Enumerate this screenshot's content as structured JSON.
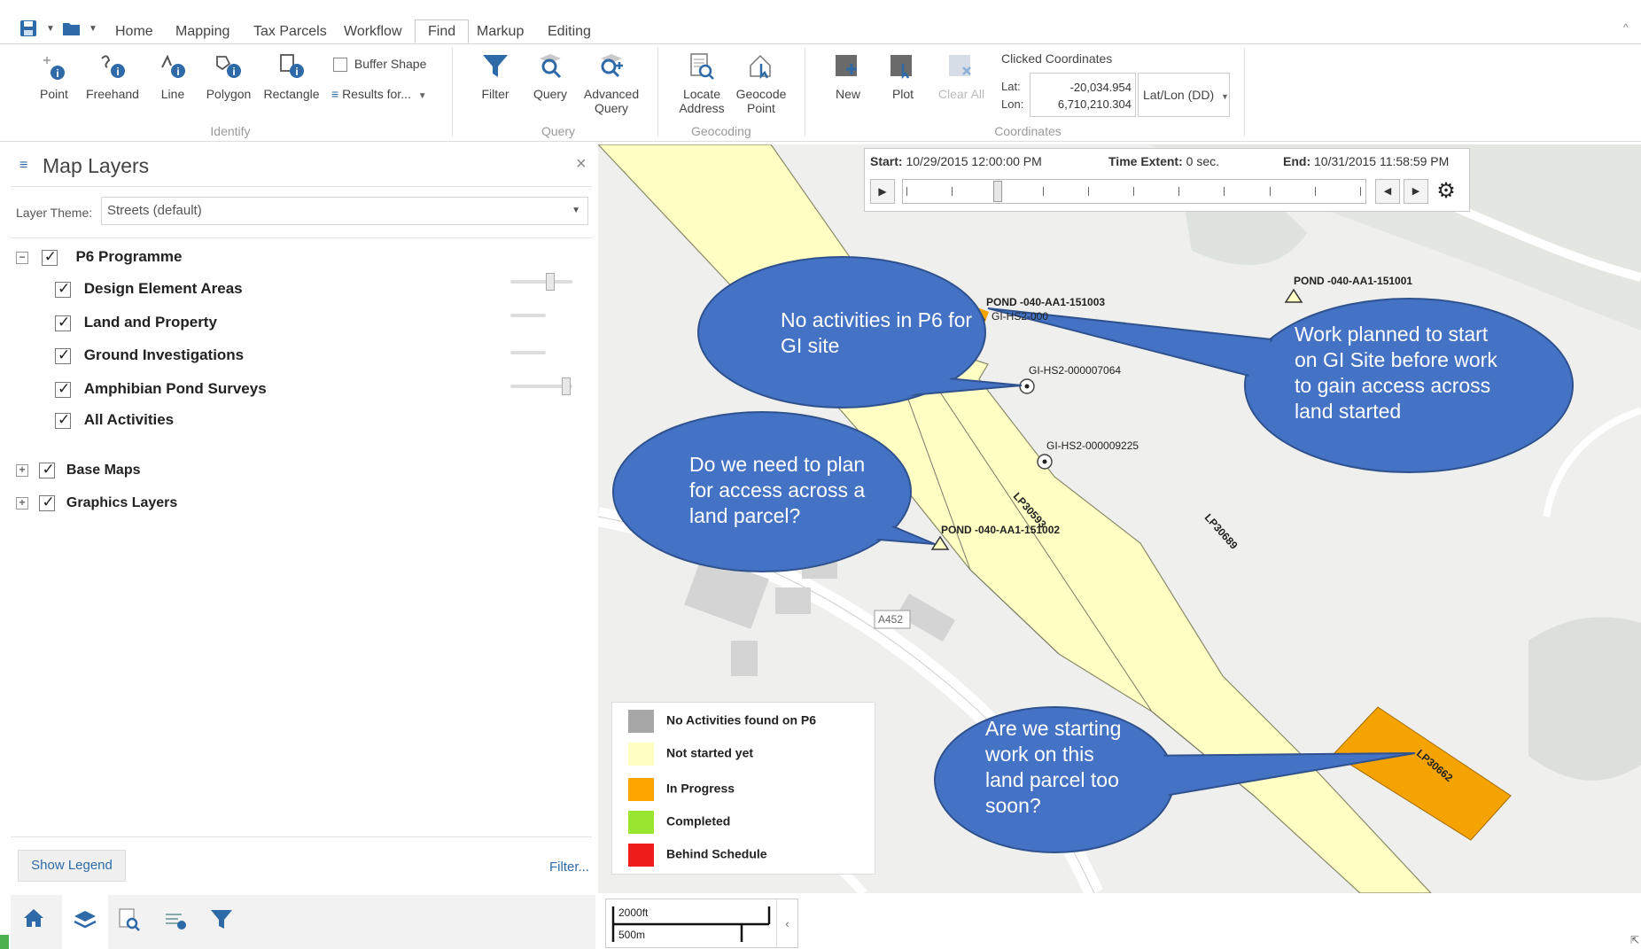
{
  "ribbon": {
    "tabs": [
      "Home",
      "Mapping",
      "Tax Parcels",
      "Workflow",
      "Find",
      "Markup",
      "Editing"
    ],
    "active_tab": "Find",
    "identify": {
      "buttons": [
        "Point",
        "Freehand",
        "Line",
        "Polygon",
        "Rectangle"
      ],
      "buffer_shape": "Buffer Shape",
      "results_for": "Results for...",
      "group_label": "Identify"
    },
    "query": {
      "filter": "Filter",
      "query": "Query",
      "advanced_line1": "Advanced",
      "advanced_line2": "Query",
      "group_label": "Query"
    },
    "geocoding": {
      "locate_line1": "Locate",
      "locate_line2": "Address",
      "geocode_line1": "Geocode",
      "geocode_line2": "Point",
      "group_label": "Geocoding"
    },
    "coordinates": {
      "new": "New",
      "plot": "Plot",
      "clear_all": "Clear All",
      "clicked_label": "Clicked Coordinates",
      "lat_label": "Lat:",
      "lon_label": "Lon:",
      "lat_value": "-20,034.954",
      "lon_value": "6,710,210.304",
      "format": "Lat/Lon (DD)",
      "group_label": "Coordinates"
    }
  },
  "panel": {
    "title": "Map Layers",
    "theme_label": "Layer Theme:",
    "theme_value": "Streets (default)",
    "group_p6": "P6 Programme",
    "layers": [
      "Design Element Areas",
      "Land and Property",
      "Ground Investigations",
      "Amphibian Pond Surveys",
      "All Activities"
    ],
    "base_maps": "Base Maps",
    "graphics_layers": "Graphics Layers",
    "show_legend": "Show Legend",
    "filter_link": "Filter..."
  },
  "timeslider": {
    "start_label": "Start:",
    "start_value": "10/29/2015 12:00:00 PM",
    "extent_label": "Time Extent:",
    "extent_value": "0 sec.",
    "end_label": "End:",
    "end_value": "10/31/2015 11:58:59 PM",
    "position": 0.2
  },
  "map": {
    "labels": {
      "pond_151003": "POND -040-AA1-151003",
      "gi_partial": "GI-HS2-000010604",
      "pond_151001": "POND -040-AA1-151001",
      "gi_7064": "GI-HS2-000007064",
      "gi_9225": "GI-HS2-000009225",
      "pond_151002": "POND -040-AA1-151002",
      "lp30593": "LP30593",
      "lp30689": "LP30689",
      "lp30662": "LP30662",
      "road": "A452"
    },
    "callouts": {
      "no_activities": "No activities in P6 for GI site",
      "work_planned": "Work planned to start on GI Site before work to gain access across land started",
      "plan_access": "Do we need to plan for access across a land parcel?",
      "starting_work": "Are we starting work on this land parcel too soon?"
    },
    "scale_ft": "2000ft",
    "scale_m": "500m"
  },
  "legend": {
    "items": [
      {
        "label": "No Activities found on P6",
        "color": "#a6a6a6"
      },
      {
        "label": "Not started yet",
        "color": "#ffffc4"
      },
      {
        "label": "In Progress",
        "color": "#ffa500"
      },
      {
        "label": "Completed",
        "color": "#99e62e"
      },
      {
        "label": "Behind Schedule",
        "color": "#ef1c1c"
      }
    ]
  },
  "colors": {
    "callout_fill": "#4472c4",
    "parcel_yellow": "#ffffc4",
    "parcel_orange": "#f5a300",
    "accent_blue": "#2e6aa8"
  }
}
